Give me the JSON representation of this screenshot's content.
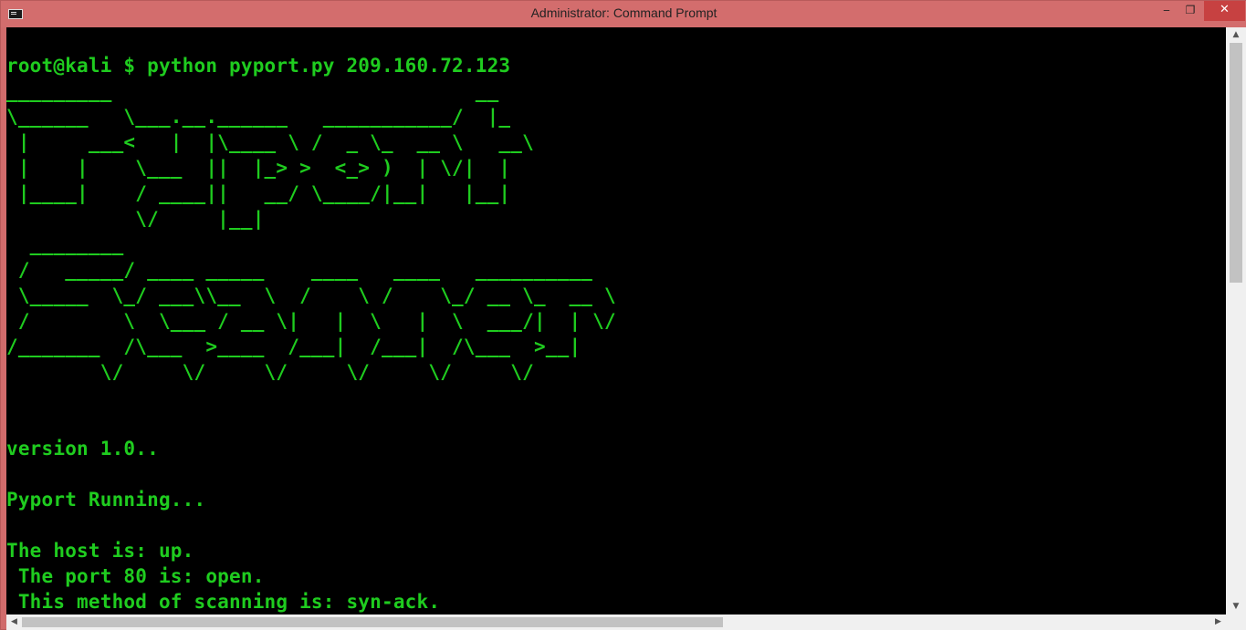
{
  "window": {
    "title": "Administrator: Command Prompt",
    "controls": {
      "minimize": "‒",
      "maximize": "❐",
      "close": "✕"
    }
  },
  "console": {
    "lines": [
      "",
      "root@kali $ python pyport.py 209.160.72.123",
      "_________                               __",
      "\\______   \\___.__.______   ___________/  |_",
      " |     ___<   |  |\\____ \\ /  _ \\_  __ \\   __\\",
      " |    |    \\___  ||  |_> >  <_> )  | \\/|  |",
      " |____|    / ____||   __/ \\____/|__|   |__|",
      "           \\/     |__|",
      "  ________",
      " /   _____/ ____ _____    ____   ____   __________",
      " \\_____  \\_/ ___\\\\__  \\  /    \\ /    \\_/ __ \\_  __ \\",
      " /        \\  \\___ / __ \\|   |  \\   |  \\  ___/|  | \\/",
      "/_______  /\\___  >____  /___|  /___|  /\\___  >__|",
      "        \\/     \\/     \\/     \\/     \\/     \\/",
      "",
      "",
      "version 1.0..",
      "",
      "Pyport Running...",
      "",
      "The host is: up.",
      " The port 80 is: open.",
      " This method of scanning is: syn-ack."
    ]
  },
  "scrollbars": {
    "vertical": {
      "up": "▲",
      "down": "▼"
    },
    "horizontal": {
      "left": "◀",
      "right": "▶"
    }
  }
}
